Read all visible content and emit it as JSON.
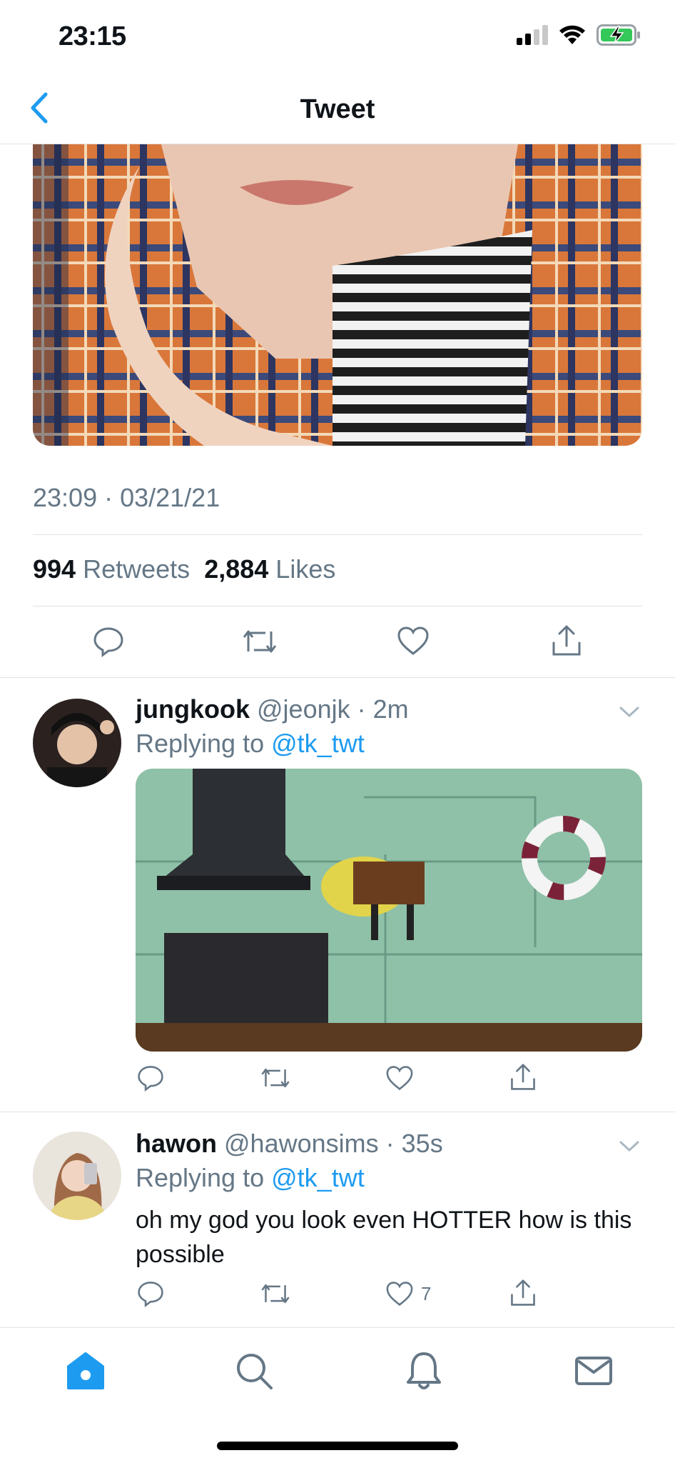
{
  "status_bar": {
    "time": "23:15"
  },
  "nav": {
    "title": "Tweet"
  },
  "tweet": {
    "timestamp": "23:09 · 03/21/21",
    "retweet_count": "994",
    "retweet_label": "Retweets",
    "like_count": "2,884",
    "like_label": "Likes"
  },
  "replies": [
    {
      "name": "jungkook",
      "handle": "@jeonjk",
      "time": "· 2m",
      "replying_prefix": "Replying to",
      "replying_to": "@tk_twt",
      "like_count": ""
    },
    {
      "name": "hawon",
      "handle": "@hawonsims",
      "time": "· 35s",
      "replying_prefix": "Replying to",
      "replying_to": "@tk_twt",
      "text": "oh my god you look even HOTTER how is this possible",
      "like_count": "7"
    }
  ],
  "colors": {
    "accent": "#1d9bf0",
    "muted": "#657786",
    "divider": "#dfe3e6"
  },
  "tabs": [
    "home-icon",
    "search-icon",
    "bell-icon",
    "mail-icon"
  ]
}
